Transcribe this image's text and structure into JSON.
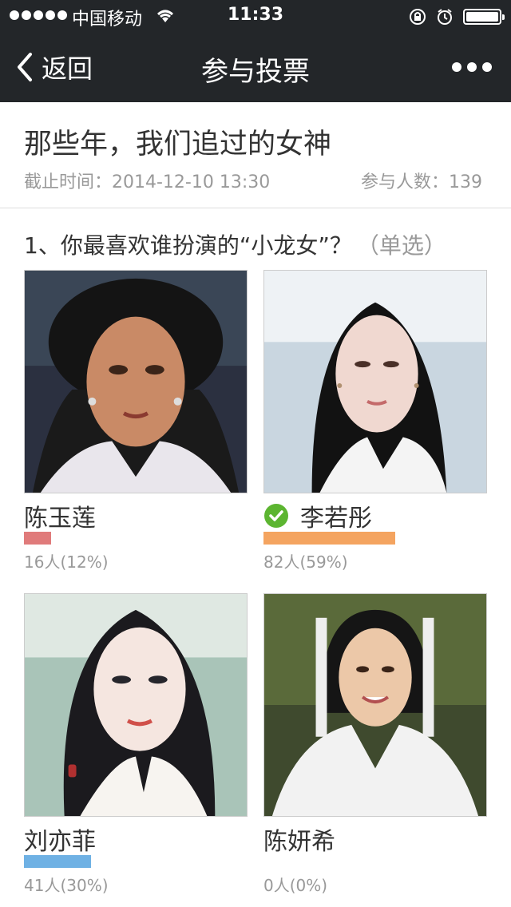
{
  "status_bar": {
    "carrier": "中国移动",
    "time": "11:33"
  },
  "nav": {
    "back_label": "返回",
    "title": "参与投票"
  },
  "vote": {
    "title": "那些年，我们追过的女神",
    "deadline": "截止时间：2014-12-10 13:30",
    "participants": "参与人数：139"
  },
  "question": {
    "text": "1、你最喜欢谁扮演的“小龙女”？",
    "type": "（单选）"
  },
  "options": [
    {
      "name": "陈玉莲",
      "result": "16人(12%)",
      "percent": 12,
      "color": "#e07b7b",
      "selected": false
    },
    {
      "name": "李若彤",
      "result": "82人(59%)",
      "percent": 59,
      "color": "#f4a460",
      "selected": true
    },
    {
      "name": "刘亦菲",
      "result": "41人(30%)",
      "percent": 30,
      "color": "#6fb1e4",
      "selected": false
    },
    {
      "name": "陈妍希",
      "result": "0人(0%)",
      "percent": 0,
      "color": "#cccccc",
      "selected": false
    }
  ],
  "colors": {
    "topbar": "#232629",
    "check": "#5cb531"
  }
}
